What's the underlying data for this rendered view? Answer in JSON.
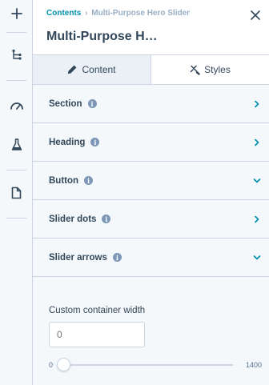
{
  "rail": {
    "icons": [
      "add-icon",
      "tree-icon",
      "gauge-icon",
      "flask-icon",
      "page-icon"
    ]
  },
  "header": {
    "breadcrumb": {
      "link": "Contents",
      "separator": "›",
      "current": "Multi-Purpose Hero Slider"
    },
    "title": "Multi-Purpose H…"
  },
  "tabs": [
    {
      "label": "Content",
      "icon": "pencil-icon",
      "active": false
    },
    {
      "label": "Styles",
      "icon": "brush-icon",
      "active": true
    }
  ],
  "sections": [
    {
      "label": "Section",
      "info": "i",
      "chevron": "right"
    },
    {
      "label": "Heading",
      "info": "i",
      "chevron": "right"
    },
    {
      "label": "Button",
      "info": "i",
      "chevron": "down"
    },
    {
      "label": "Slider dots",
      "info": "i",
      "chevron": "right"
    },
    {
      "label": "Slider arrows",
      "info": "i",
      "chevron": "down"
    }
  ],
  "custom_width": {
    "label": "Custom container width",
    "value": "",
    "placeholder": "0",
    "slider_min": "0",
    "slider_max": "1400",
    "slider_value": 0
  },
  "colors": {
    "link": "#0091ae",
    "text": "#33475b",
    "muted": "#99afc4",
    "border": "#cbd6e2",
    "panel_bg": "#f5f8fa"
  }
}
